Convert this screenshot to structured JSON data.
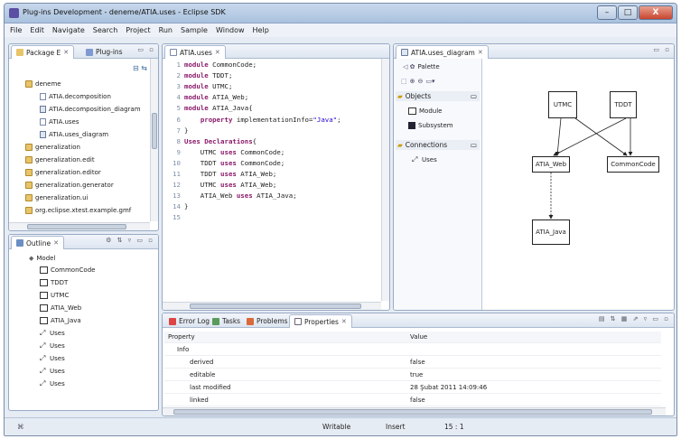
{
  "window": {
    "title": "Plug-ins Development - deneme/ATIA.uses - Eclipse SDK",
    "controls": [
      "–",
      "□",
      "X"
    ]
  },
  "menu": [
    "File",
    "Edit",
    "Navigate",
    "Search",
    "Project",
    "Run",
    "Sample",
    "Window",
    "Help"
  ],
  "package_explorer": {
    "tabs": [
      "Package E",
      "Plug-ins"
    ],
    "items": [
      {
        "label": "deneme",
        "icon": "project-icon"
      },
      {
        "label": "ATIA.decomposition",
        "icon": "file-icon"
      },
      {
        "label": "ATIA.decomposition_diagram",
        "icon": "file-icon"
      },
      {
        "label": "ATIA.uses",
        "icon": "file-icon"
      },
      {
        "label": "ATIA.uses_diagram",
        "icon": "file-icon"
      },
      {
        "label": "generalization",
        "icon": "plugin-project-icon"
      },
      {
        "label": "generalization.edit",
        "icon": "plugin-project-icon"
      },
      {
        "label": "generalization.editor",
        "icon": "plugin-project-icon"
      },
      {
        "label": "generalization.generator",
        "icon": "plugin-project-icon"
      },
      {
        "label": "generalization.ui",
        "icon": "plugin-project-icon"
      },
      {
        "label": "org.eclipse.xtest.example.gmf",
        "icon": "plugin-project-icon"
      }
    ]
  },
  "outline": {
    "tab": "Outline",
    "root": "Model",
    "items": [
      "CommonCode",
      "TDDT",
      "UTMC",
      "ATIA_Web",
      "ATIA_Java",
      "Uses",
      "Uses",
      "Uses",
      "Uses",
      "Uses"
    ]
  },
  "editor": {
    "tab": "ATIA.uses",
    "lines": [
      {
        "n": "1",
        "parts": [
          {
            "k": "kw",
            "t": "module"
          },
          {
            "k": "plain",
            "t": " CommonCode;"
          }
        ]
      },
      {
        "n": "2",
        "parts": [
          {
            "k": "kw",
            "t": "module"
          },
          {
            "k": "plain",
            "t": " TDDT;"
          }
        ]
      },
      {
        "n": "3",
        "parts": [
          {
            "k": "kw",
            "t": "module"
          },
          {
            "k": "plain",
            "t": " UTMC;"
          }
        ]
      },
      {
        "n": "4",
        "parts": [
          {
            "k": "kw",
            "t": "module"
          },
          {
            "k": "plain",
            "t": " ATIA_Web;"
          }
        ]
      },
      {
        "n": "5",
        "parts": [
          {
            "k": "kw",
            "t": "module"
          },
          {
            "k": "plain",
            "t": " ATIA_Java{"
          }
        ]
      },
      {
        "n": "6",
        "parts": [
          {
            "k": "plain",
            "t": "    "
          },
          {
            "k": "kw",
            "t": "property"
          },
          {
            "k": "plain",
            "t": " implementationInfo="
          },
          {
            "k": "str",
            "t": "\"Java\""
          },
          {
            "k": "plain",
            "t": ";"
          }
        ]
      },
      {
        "n": "7",
        "parts": [
          {
            "k": "plain",
            "t": "}"
          }
        ]
      },
      {
        "n": "8",
        "parts": [
          {
            "k": "kw",
            "t": "Uses Declarations"
          },
          {
            "k": "plain",
            "t": "{"
          }
        ]
      },
      {
        "n": "9",
        "parts": [
          {
            "k": "plain",
            "t": "    UTMC "
          },
          {
            "k": "kw",
            "t": "uses"
          },
          {
            "k": "plain",
            "t": " CommonCode;"
          }
        ]
      },
      {
        "n": "10",
        "parts": [
          {
            "k": "plain",
            "t": "    TDDT "
          },
          {
            "k": "kw",
            "t": "uses"
          },
          {
            "k": "plain",
            "t": " CommonCode;"
          }
        ]
      },
      {
        "n": "11",
        "parts": [
          {
            "k": "plain",
            "t": "    TDDT "
          },
          {
            "k": "kw",
            "t": "uses"
          },
          {
            "k": "plain",
            "t": " ATIA_Web;"
          }
        ]
      },
      {
        "n": "12",
        "parts": [
          {
            "k": "plain",
            "t": "    UTMC "
          },
          {
            "k": "kw",
            "t": "uses"
          },
          {
            "k": "plain",
            "t": " ATIA_Web;"
          }
        ]
      },
      {
        "n": "13",
        "parts": [
          {
            "k": "plain",
            "t": "    ATIA_Web "
          },
          {
            "k": "kw",
            "t": "uses"
          },
          {
            "k": "plain",
            "t": " ATIA_Java;"
          }
        ]
      },
      {
        "n": "14",
        "parts": [
          {
            "k": "plain",
            "t": "}"
          }
        ]
      },
      {
        "n": "15",
        "parts": []
      }
    ]
  },
  "diagram": {
    "tab": "ATIA.uses_diagram",
    "palette": {
      "title": "Palette",
      "groups": [
        {
          "name": "Objects",
          "items": [
            "Module",
            "Subsystem"
          ]
        },
        {
          "name": "Connections",
          "items": [
            "Uses"
          ]
        }
      ]
    },
    "nodes": [
      "UTMC",
      "TDDT",
      "ATIA_Web",
      "CommonCode",
      "ATIA_Java"
    ]
  },
  "bottom": {
    "tabs": [
      "Error Log",
      "Tasks",
      "Problems",
      "Properties"
    ],
    "columns": [
      "Property",
      "Value"
    ],
    "rows": [
      {
        "p": "Info",
        "v": ""
      },
      {
        "p": "derived",
        "v": "false"
      },
      {
        "p": "editable",
        "v": "true"
      },
      {
        "p": "last modified",
        "v": "28 Şubat 2011 14:09:46"
      },
      {
        "p": "linked",
        "v": "false"
      }
    ]
  },
  "status": {
    "writable": "Writable",
    "insert": "Insert",
    "position": "15 : 1"
  }
}
